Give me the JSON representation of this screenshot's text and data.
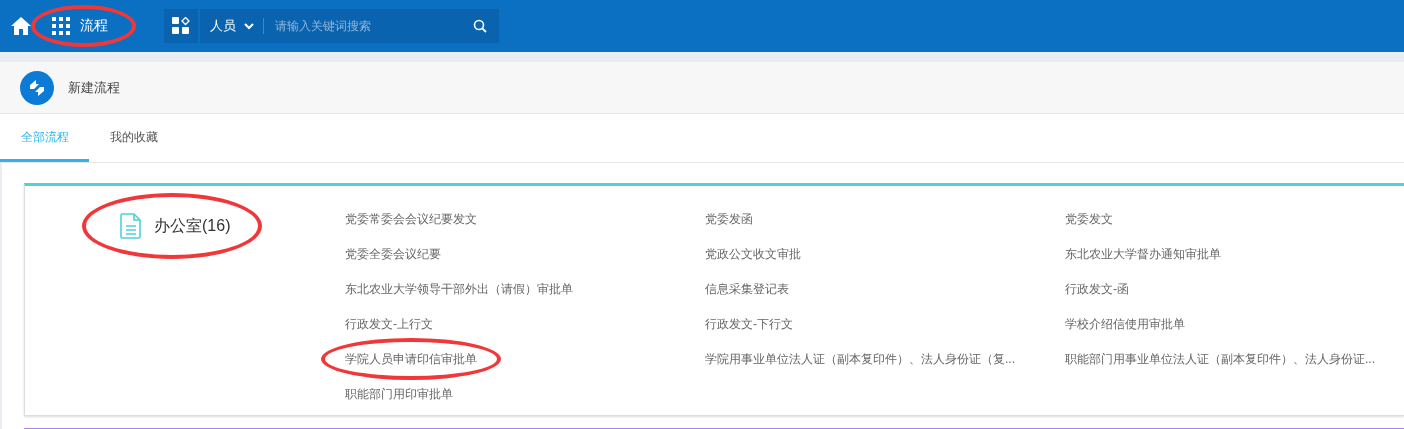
{
  "top_bar": {
    "nav": {
      "label": "流程",
      "circled": true
    },
    "search": {
      "scope": "人员",
      "placeholder": "请输入关键词搜索"
    }
  },
  "header": {
    "title": "新建流程"
  },
  "tabs": [
    {
      "label": "全部流程",
      "selected": true
    },
    {
      "label": "我的收藏",
      "selected": false
    }
  ],
  "categories": [
    {
      "title": "办公室(16)",
      "color": "#4fd1d6",
      "circled": true,
      "items": [
        {
          "label": "党委常委会会议纪要发文",
          "circled": false
        },
        {
          "label": "党委发函",
          "circled": false
        },
        {
          "label": "党委发文",
          "circled": false
        },
        {
          "label": "党委全委会议纪要",
          "circled": false
        },
        {
          "label": "党政公文收文审批",
          "circled": false
        },
        {
          "label": "东北农业大学督办通知审批单",
          "circled": false
        },
        {
          "label": "东北农业大学领导干部外出（请假）审批单",
          "circled": false
        },
        {
          "label": "信息采集登记表",
          "circled": false
        },
        {
          "label": "行政发文-函",
          "circled": false
        },
        {
          "label": "行政发文-上行文",
          "circled": false
        },
        {
          "label": "行政发文-下行文",
          "circled": false
        },
        {
          "label": "学校介绍信使用审批单",
          "circled": false
        },
        {
          "label": "学院人员申请印信审批单",
          "circled": true
        },
        {
          "label": "学院用事业单位法人证（副本复印件）、法人身份证（复...",
          "circled": false
        },
        {
          "label": "职能部门用事业单位法人证（副本复印件）、法人身份证...",
          "circled": false
        },
        {
          "label": "职能部门用印审批单",
          "circled": false
        }
      ]
    },
    {
      "color": "#b07cf0"
    }
  ]
}
